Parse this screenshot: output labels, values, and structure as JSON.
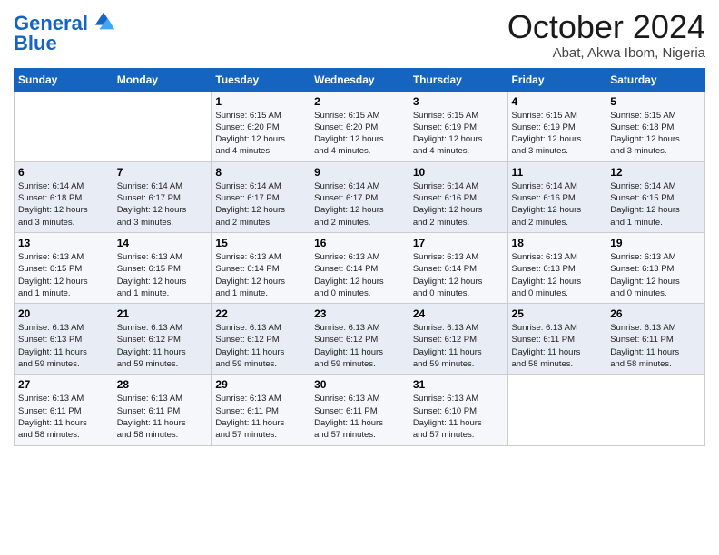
{
  "header": {
    "logo": {
      "line1": "General",
      "line2": "Blue"
    },
    "title": "October 2024",
    "location": "Abat, Akwa Ibom, Nigeria"
  },
  "weekdays": [
    "Sunday",
    "Monday",
    "Tuesday",
    "Wednesday",
    "Thursday",
    "Friday",
    "Saturday"
  ],
  "weeks": [
    [
      {
        "day": "",
        "info": ""
      },
      {
        "day": "",
        "info": ""
      },
      {
        "day": "1",
        "info": "Sunrise: 6:15 AM\nSunset: 6:20 PM\nDaylight: 12 hours\nand 4 minutes."
      },
      {
        "day": "2",
        "info": "Sunrise: 6:15 AM\nSunset: 6:20 PM\nDaylight: 12 hours\nand 4 minutes."
      },
      {
        "day": "3",
        "info": "Sunrise: 6:15 AM\nSunset: 6:19 PM\nDaylight: 12 hours\nand 4 minutes."
      },
      {
        "day": "4",
        "info": "Sunrise: 6:15 AM\nSunset: 6:19 PM\nDaylight: 12 hours\nand 3 minutes."
      },
      {
        "day": "5",
        "info": "Sunrise: 6:15 AM\nSunset: 6:18 PM\nDaylight: 12 hours\nand 3 minutes."
      }
    ],
    [
      {
        "day": "6",
        "info": "Sunrise: 6:14 AM\nSunset: 6:18 PM\nDaylight: 12 hours\nand 3 minutes."
      },
      {
        "day": "7",
        "info": "Sunrise: 6:14 AM\nSunset: 6:17 PM\nDaylight: 12 hours\nand 3 minutes."
      },
      {
        "day": "8",
        "info": "Sunrise: 6:14 AM\nSunset: 6:17 PM\nDaylight: 12 hours\nand 2 minutes."
      },
      {
        "day": "9",
        "info": "Sunrise: 6:14 AM\nSunset: 6:17 PM\nDaylight: 12 hours\nand 2 minutes."
      },
      {
        "day": "10",
        "info": "Sunrise: 6:14 AM\nSunset: 6:16 PM\nDaylight: 12 hours\nand 2 minutes."
      },
      {
        "day": "11",
        "info": "Sunrise: 6:14 AM\nSunset: 6:16 PM\nDaylight: 12 hours\nand 2 minutes."
      },
      {
        "day": "12",
        "info": "Sunrise: 6:14 AM\nSunset: 6:15 PM\nDaylight: 12 hours\nand 1 minute."
      }
    ],
    [
      {
        "day": "13",
        "info": "Sunrise: 6:13 AM\nSunset: 6:15 PM\nDaylight: 12 hours\nand 1 minute."
      },
      {
        "day": "14",
        "info": "Sunrise: 6:13 AM\nSunset: 6:15 PM\nDaylight: 12 hours\nand 1 minute."
      },
      {
        "day": "15",
        "info": "Sunrise: 6:13 AM\nSunset: 6:14 PM\nDaylight: 12 hours\nand 1 minute."
      },
      {
        "day": "16",
        "info": "Sunrise: 6:13 AM\nSunset: 6:14 PM\nDaylight: 12 hours\nand 0 minutes."
      },
      {
        "day": "17",
        "info": "Sunrise: 6:13 AM\nSunset: 6:14 PM\nDaylight: 12 hours\nand 0 minutes."
      },
      {
        "day": "18",
        "info": "Sunrise: 6:13 AM\nSunset: 6:13 PM\nDaylight: 12 hours\nand 0 minutes."
      },
      {
        "day": "19",
        "info": "Sunrise: 6:13 AM\nSunset: 6:13 PM\nDaylight: 12 hours\nand 0 minutes."
      }
    ],
    [
      {
        "day": "20",
        "info": "Sunrise: 6:13 AM\nSunset: 6:13 PM\nDaylight: 11 hours\nand 59 minutes."
      },
      {
        "day": "21",
        "info": "Sunrise: 6:13 AM\nSunset: 6:12 PM\nDaylight: 11 hours\nand 59 minutes."
      },
      {
        "day": "22",
        "info": "Sunrise: 6:13 AM\nSunset: 6:12 PM\nDaylight: 11 hours\nand 59 minutes."
      },
      {
        "day": "23",
        "info": "Sunrise: 6:13 AM\nSunset: 6:12 PM\nDaylight: 11 hours\nand 59 minutes."
      },
      {
        "day": "24",
        "info": "Sunrise: 6:13 AM\nSunset: 6:12 PM\nDaylight: 11 hours\nand 59 minutes."
      },
      {
        "day": "25",
        "info": "Sunrise: 6:13 AM\nSunset: 6:11 PM\nDaylight: 11 hours\nand 58 minutes."
      },
      {
        "day": "26",
        "info": "Sunrise: 6:13 AM\nSunset: 6:11 PM\nDaylight: 11 hours\nand 58 minutes."
      }
    ],
    [
      {
        "day": "27",
        "info": "Sunrise: 6:13 AM\nSunset: 6:11 PM\nDaylight: 11 hours\nand 58 minutes."
      },
      {
        "day": "28",
        "info": "Sunrise: 6:13 AM\nSunset: 6:11 PM\nDaylight: 11 hours\nand 58 minutes."
      },
      {
        "day": "29",
        "info": "Sunrise: 6:13 AM\nSunset: 6:11 PM\nDaylight: 11 hours\nand 57 minutes."
      },
      {
        "day": "30",
        "info": "Sunrise: 6:13 AM\nSunset: 6:11 PM\nDaylight: 11 hours\nand 57 minutes."
      },
      {
        "day": "31",
        "info": "Sunrise: 6:13 AM\nSunset: 6:10 PM\nDaylight: 11 hours\nand 57 minutes."
      },
      {
        "day": "",
        "info": ""
      },
      {
        "day": "",
        "info": ""
      }
    ]
  ]
}
